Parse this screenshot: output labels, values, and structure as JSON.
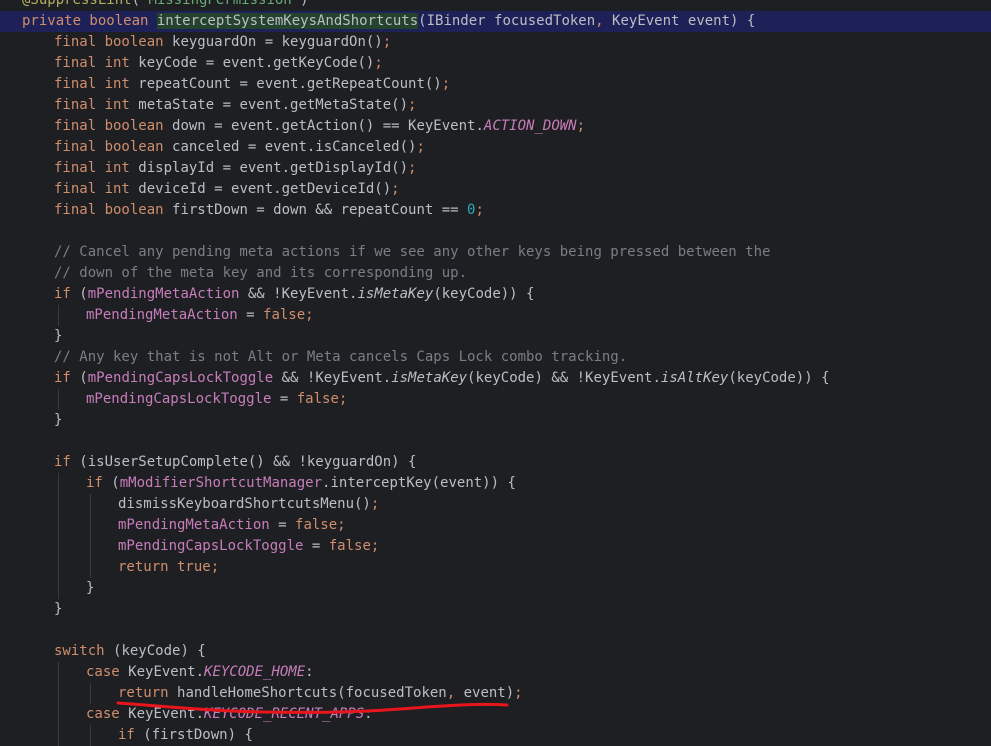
{
  "editor": {
    "language": "java",
    "lines": [
      {
        "indent": 0,
        "tokens": [
          [
            "ann",
            "@SuppressLint"
          ],
          [
            "id",
            "("
          ],
          [
            "str",
            "\"MissingPermission\""
          ],
          [
            "id",
            ")"
          ]
        ]
      },
      {
        "indent": 0,
        "highlight": true,
        "tokens": [
          [
            "kw",
            "private boolean "
          ],
          [
            "decl",
            "interceptSystemKeysAndShortcuts"
          ],
          [
            "id",
            "(IBinder focusedToken"
          ],
          [
            "kw",
            ", "
          ],
          [
            "id",
            "KeyEvent event) {"
          ]
        ]
      },
      {
        "indent": 1,
        "tokens": [
          [
            "kw",
            "final boolean "
          ],
          [
            "id",
            "keyguardOn = keyguardOn()"
          ],
          [
            "kw",
            ";"
          ]
        ]
      },
      {
        "indent": 1,
        "tokens": [
          [
            "kw",
            "final int "
          ],
          [
            "id",
            "keyCode = event.getKeyCode()"
          ],
          [
            "kw",
            ";"
          ]
        ]
      },
      {
        "indent": 1,
        "tokens": [
          [
            "kw",
            "final int "
          ],
          [
            "id",
            "repeatCount = event.getRepeatCount()"
          ],
          [
            "kw",
            ";"
          ]
        ]
      },
      {
        "indent": 1,
        "tokens": [
          [
            "kw",
            "final int "
          ],
          [
            "id",
            "metaState = event.getMetaState()"
          ],
          [
            "kw",
            ";"
          ]
        ]
      },
      {
        "indent": 1,
        "tokens": [
          [
            "kw",
            "final boolean "
          ],
          [
            "id",
            "down = event.getAction() == KeyEvent."
          ],
          [
            "cst",
            "ACTION_DOWN"
          ],
          [
            "kw",
            ";"
          ]
        ]
      },
      {
        "indent": 1,
        "tokens": [
          [
            "kw",
            "final boolean "
          ],
          [
            "id",
            "canceled = event.isCanceled()"
          ],
          [
            "kw",
            ";"
          ]
        ]
      },
      {
        "indent": 1,
        "tokens": [
          [
            "kw",
            "final int "
          ],
          [
            "id",
            "displayId = event.getDisplayId()"
          ],
          [
            "kw",
            ";"
          ]
        ]
      },
      {
        "indent": 1,
        "tokens": [
          [
            "kw",
            "final int "
          ],
          [
            "id",
            "deviceId = event.getDeviceId()"
          ],
          [
            "kw",
            ";"
          ]
        ]
      },
      {
        "indent": 1,
        "tokens": [
          [
            "kw",
            "final boolean "
          ],
          [
            "id",
            "firstDown = down && repeatCount == "
          ],
          [
            "num",
            "0"
          ],
          [
            "kw",
            ";"
          ]
        ]
      },
      {
        "indent": 1,
        "tokens": []
      },
      {
        "indent": 1,
        "tokens": [
          [
            "cmt",
            "// Cancel any pending meta actions if we see any other keys being pressed between the"
          ]
        ]
      },
      {
        "indent": 1,
        "tokens": [
          [
            "cmt",
            "// down of the meta key and its corresponding up."
          ]
        ]
      },
      {
        "indent": 1,
        "tokens": [
          [
            "kw",
            "if "
          ],
          [
            "id",
            "("
          ],
          [
            "fld",
            "mPendingMetaAction"
          ],
          [
            "id",
            " && !KeyEvent."
          ],
          [
            "st",
            "isMetaKey"
          ],
          [
            "id",
            "(keyCode)) {"
          ]
        ]
      },
      {
        "indent": 2,
        "tokens": [
          [
            "fld",
            "mPendingMetaAction"
          ],
          [
            "id",
            " = "
          ],
          [
            "kw",
            "false;"
          ]
        ]
      },
      {
        "indent": 1,
        "tokens": [
          [
            "id",
            "}"
          ]
        ]
      },
      {
        "indent": 1,
        "tokens": [
          [
            "cmt",
            "// Any key that is not Alt or Meta cancels Caps Lock combo tracking."
          ]
        ]
      },
      {
        "indent": 1,
        "tokens": [
          [
            "kw",
            "if "
          ],
          [
            "id",
            "("
          ],
          [
            "fld",
            "mPendingCapsLockToggle"
          ],
          [
            "id",
            " && !KeyEvent."
          ],
          [
            "st",
            "isMetaKey"
          ],
          [
            "id",
            "(keyCode) && !KeyEvent."
          ],
          [
            "st",
            "isAltKey"
          ],
          [
            "id",
            "(keyCode)) {"
          ]
        ]
      },
      {
        "indent": 2,
        "tokens": [
          [
            "fld",
            "mPendingCapsLockToggle"
          ],
          [
            "id",
            " = "
          ],
          [
            "kw",
            "false;"
          ]
        ]
      },
      {
        "indent": 1,
        "tokens": [
          [
            "id",
            "}"
          ]
        ]
      },
      {
        "indent": 1,
        "tokens": []
      },
      {
        "indent": 1,
        "tokens": [
          [
            "kw",
            "if "
          ],
          [
            "id",
            "(isUserSetupComplete() && !keyguardOn) {"
          ]
        ]
      },
      {
        "indent": 2,
        "tokens": [
          [
            "kw",
            "if "
          ],
          [
            "id",
            "("
          ],
          [
            "fld",
            "mModifierShortcutManager"
          ],
          [
            "id",
            ".interceptKey(event)) {"
          ]
        ]
      },
      {
        "indent": 3,
        "tokens": [
          [
            "id",
            "dismissKeyboardShortcutsMenu()"
          ],
          [
            "kw",
            ";"
          ]
        ]
      },
      {
        "indent": 3,
        "tokens": [
          [
            "fld",
            "mPendingMetaAction"
          ],
          [
            "id",
            " = "
          ],
          [
            "kw",
            "false;"
          ]
        ]
      },
      {
        "indent": 3,
        "tokens": [
          [
            "fld",
            "mPendingCapsLockToggle"
          ],
          [
            "id",
            " = "
          ],
          [
            "kw",
            "false;"
          ]
        ]
      },
      {
        "indent": 3,
        "tokens": [
          [
            "kw",
            "return true;"
          ]
        ]
      },
      {
        "indent": 2,
        "tokens": [
          [
            "id",
            "}"
          ]
        ]
      },
      {
        "indent": 1,
        "tokens": [
          [
            "id",
            "}"
          ]
        ]
      },
      {
        "indent": 1,
        "tokens": []
      },
      {
        "indent": 1,
        "tokens": [
          [
            "kw",
            "switch "
          ],
          [
            "id",
            "(keyCode) {"
          ]
        ]
      },
      {
        "indent": 2,
        "tokens": [
          [
            "kw",
            "case "
          ],
          [
            "id",
            "KeyEvent."
          ],
          [
            "cst",
            "KEYCODE_HOME"
          ],
          [
            "id",
            ":"
          ]
        ]
      },
      {
        "indent": 3,
        "tokens": [
          [
            "kw",
            "return "
          ],
          [
            "id",
            "handleHomeShortcuts(focusedToken"
          ],
          [
            "kw",
            ", "
          ],
          [
            "id",
            "event)"
          ],
          [
            "kw",
            ";"
          ]
        ]
      },
      {
        "indent": 2,
        "tokens": [
          [
            "kw",
            "case "
          ],
          [
            "id",
            "KeyEvent."
          ],
          [
            "cst",
            "KEYCODE_RECENT_APPS"
          ],
          [
            "id",
            ":"
          ]
        ]
      },
      {
        "indent": 3,
        "tokens": [
          [
            "kw",
            "if "
          ],
          [
            "id",
            "(firstDown) {"
          ]
        ]
      }
    ]
  },
  "annotation": {
    "kind": "hand-drawn underline",
    "color": "#e8151b"
  }
}
